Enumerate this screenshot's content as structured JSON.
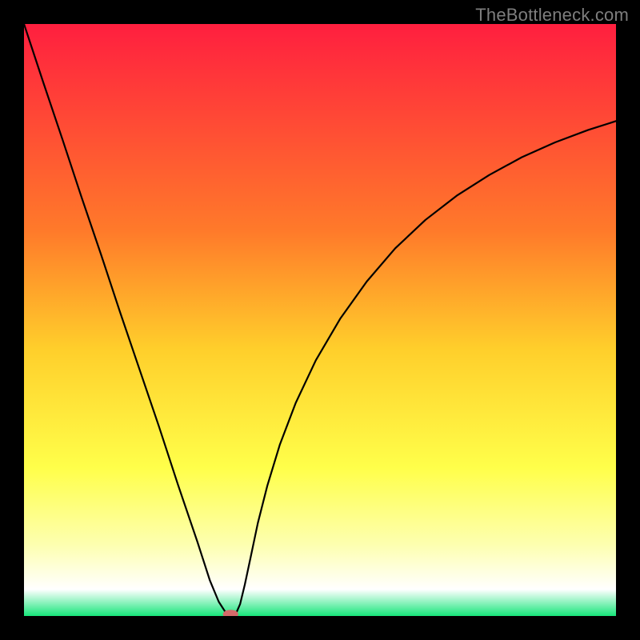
{
  "watermark": "TheBottleneck.com",
  "chart_data": {
    "type": "line",
    "title": "",
    "xlabel": "",
    "ylabel": "",
    "xlim": [
      0,
      1
    ],
    "ylim": [
      0,
      1
    ],
    "background_gradient": [
      {
        "pos": 0.0,
        "color": "#ff1f3f"
      },
      {
        "pos": 0.35,
        "color": "#ff7a2a"
      },
      {
        "pos": 0.55,
        "color": "#ffcf2b"
      },
      {
        "pos": 0.75,
        "color": "#ffff4a"
      },
      {
        "pos": 0.88,
        "color": "#fdffb0"
      },
      {
        "pos": 0.955,
        "color": "#ffffff"
      },
      {
        "pos": 1.0,
        "color": "#17e67a"
      }
    ],
    "series": [
      {
        "name": "bottleneck-curve",
        "x": [
          0.0,
          0.032,
          0.065,
          0.097,
          0.13,
          0.162,
          0.195,
          0.228,
          0.26,
          0.293,
          0.314,
          0.329,
          0.34,
          0.346,
          0.352,
          0.358,
          0.365,
          0.373,
          0.383,
          0.395,
          0.411,
          0.432,
          0.459,
          0.493,
          0.534,
          0.579,
          0.627,
          0.678,
          0.731,
          0.786,
          0.841,
          0.897,
          0.953,
          1.0
        ],
        "y": [
          1.0,
          0.903,
          0.805,
          0.708,
          0.611,
          0.514,
          0.417,
          0.32,
          0.222,
          0.125,
          0.06,
          0.024,
          0.007,
          0.0,
          0.0,
          0.004,
          0.02,
          0.053,
          0.1,
          0.157,
          0.22,
          0.289,
          0.36,
          0.432,
          0.502,
          0.565,
          0.621,
          0.669,
          0.71,
          0.745,
          0.775,
          0.8,
          0.821,
          0.836
        ]
      }
    ],
    "marker": {
      "x": 0.349,
      "y": 0.003,
      "rx": 0.013,
      "ry": 0.0075,
      "color": "#d46a6a"
    }
  }
}
